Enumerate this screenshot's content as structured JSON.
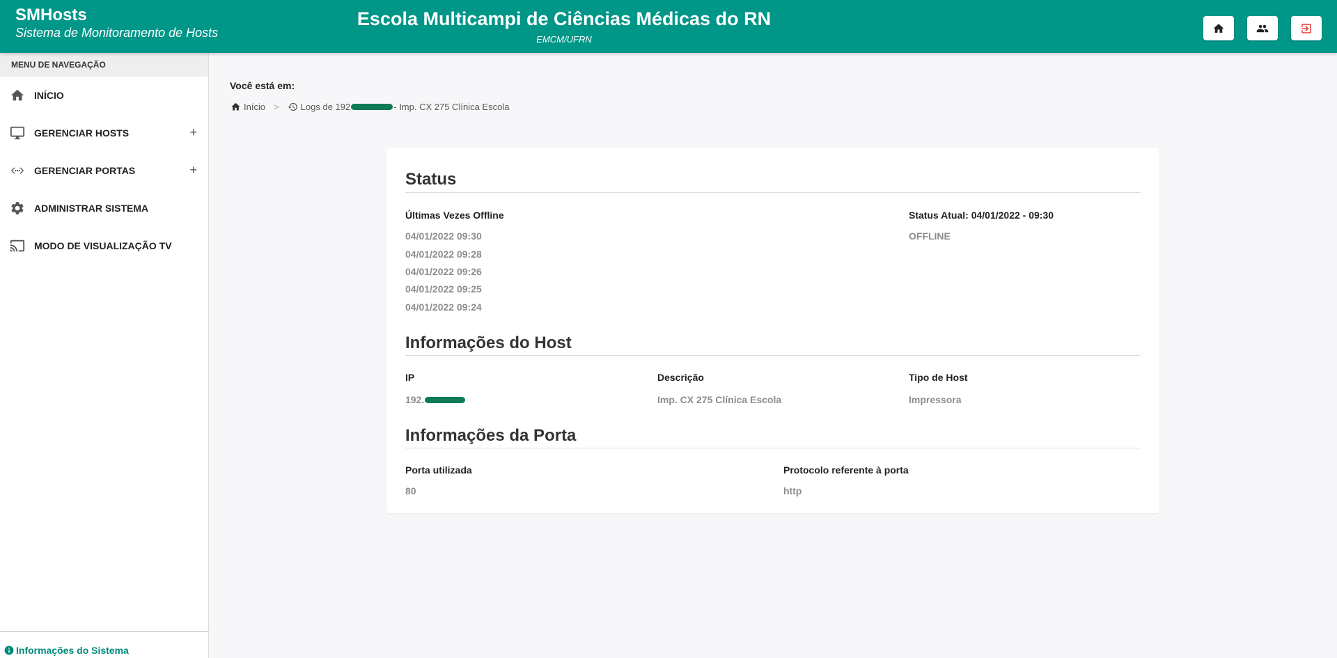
{
  "header": {
    "brand_title": "SMHosts",
    "brand_subtitle": "Sistema de Monitoramento de Hosts",
    "institution": "Escola Multicampi de Ciências Médicas do RN",
    "institution_short": "EMCM/UFRN",
    "buttons": [
      {
        "icon": "home-icon"
      },
      {
        "icon": "people-icon"
      },
      {
        "icon": "logout-icon"
      }
    ]
  },
  "sidebar": {
    "menu_title": "MENU DE NAVEGAÇÃO",
    "items": [
      {
        "label": "INÍCIO",
        "icon": "home-icon"
      },
      {
        "label": "GERENCIAR HOSTS",
        "icon": "monitor-icon",
        "expand": "+"
      },
      {
        "label": "GERENCIAR PORTAS",
        "icon": "ports-icon",
        "expand": "+"
      },
      {
        "label": "ADMINISTRAR SISTEMA",
        "icon": "gear-icon"
      },
      {
        "label": "MODO DE VISUALIZAÇÃO TV",
        "icon": "cast-icon"
      }
    ],
    "footer": "Informações do Sistema"
  },
  "breadcrumb": {
    "title": "Você está em:",
    "home": "Início",
    "separator": ">",
    "current_prefix": "Logs de 192",
    "current_suffix": "- Imp. CX 275 Clínica Escola"
  },
  "status": {
    "title": "Status",
    "offline_label": "Últimas Vezes Offline",
    "offline_times": [
      "04/01/2022 09:30",
      "04/01/2022 09:28",
      "04/01/2022 09:26",
      "04/01/2022 09:25",
      "04/01/2022 09:24"
    ],
    "current_label": "Status Atual: 04/01/2022 - 09:30",
    "current_value": "OFFLINE"
  },
  "host": {
    "title": "Informações do Host",
    "ip_label": "IP",
    "ip_value": "192.",
    "desc_label": "Descrição",
    "desc_value": "Imp. CX 275 Clínica Escola",
    "type_label": "Tipo de Host",
    "type_value": "Impressora"
  },
  "port": {
    "title": "Informações da Porta",
    "port_label": "Porta utilizada",
    "port_value": "80",
    "protocol_label": "Protocolo referente à porta",
    "protocol_value": "http"
  },
  "colors": {
    "primary": "#009688",
    "muted_value": "#8d8d8d",
    "logout": "#e53935",
    "redaction": "#0e7a57"
  }
}
